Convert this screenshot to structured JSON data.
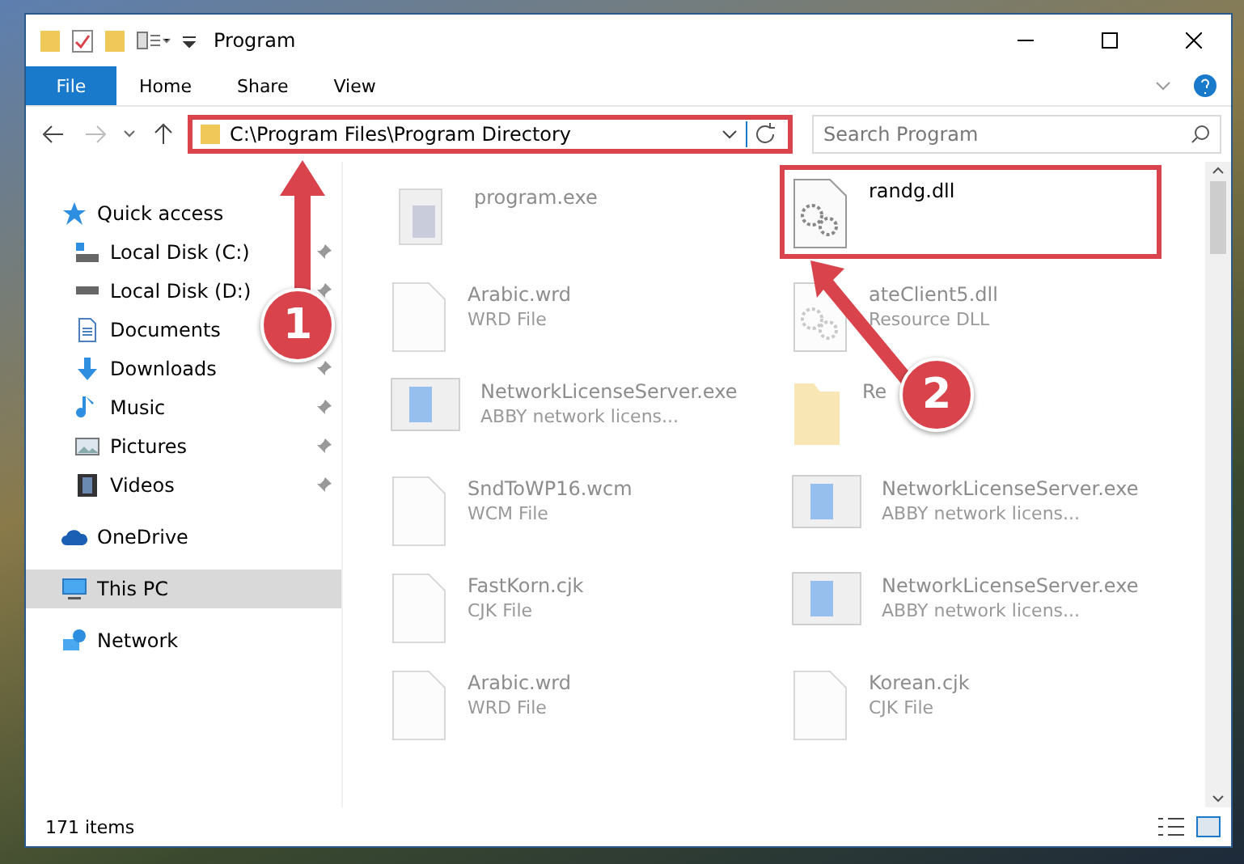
{
  "window": {
    "title": "Program"
  },
  "ribbon_tabs": [
    {
      "label": "File",
      "selected": true
    },
    {
      "label": "Home",
      "selected": false
    },
    {
      "label": "Share",
      "selected": false
    },
    {
      "label": "View",
      "selected": false
    }
  ],
  "address_bar": {
    "value": "C:\\Program Files\\Program Directory",
    "highlighted": true
  },
  "search": {
    "placeholder": "Search Program"
  },
  "sidebar": {
    "items": [
      {
        "label": "Quick access",
        "kind": "star",
        "pinned": false,
        "selected": false,
        "group": true
      },
      {
        "label": "Local Disk (C:)",
        "kind": "drive-c",
        "pinned": true,
        "selected": false,
        "group": false
      },
      {
        "label": "Local Disk (D:)",
        "kind": "drive",
        "pinned": true,
        "selected": false,
        "group": false
      },
      {
        "label": "Documents",
        "kind": "docs",
        "pinned": false,
        "selected": false,
        "group": false
      },
      {
        "label": "Downloads",
        "kind": "download",
        "pinned": true,
        "selected": false,
        "group": false
      },
      {
        "label": "Music",
        "kind": "music",
        "pinned": true,
        "selected": false,
        "group": false
      },
      {
        "label": "Pictures",
        "kind": "pictures",
        "pinned": true,
        "selected": false,
        "group": false
      },
      {
        "label": "Videos",
        "kind": "videos",
        "pinned": true,
        "selected": false,
        "group": false
      },
      {
        "label": "OneDrive",
        "kind": "cloud",
        "pinned": false,
        "selected": false,
        "group": true
      },
      {
        "label": "This PC",
        "kind": "pc",
        "pinned": false,
        "selected": true,
        "group": true
      },
      {
        "label": "Network",
        "kind": "network",
        "pinned": false,
        "selected": false,
        "group": true
      }
    ]
  },
  "files": [
    {
      "name": "program.exe",
      "kind": "app",
      "faded": true,
      "highlighted": false
    },
    {
      "name": "randg.dll",
      "kind": "dll",
      "faded": false,
      "highlighted": true
    },
    {
      "name": "Arabic.wrd",
      "type": "WRD File",
      "kind": "doc",
      "faded": true,
      "highlighted": false
    },
    {
      "name": "ateClient5.dll",
      "type": "Resource DLL",
      "kind": "dll",
      "faded": true,
      "highlighted": false
    },
    {
      "name": "NetworkLicenseServer.exe",
      "type": "ABBY network licens...",
      "kind": "window",
      "faded": true,
      "highlighted": false
    },
    {
      "name": "Re",
      "kind": "folder",
      "faded": true,
      "highlighted": false
    },
    {
      "name": "SndToWP16.wcm",
      "type": "WCM File",
      "kind": "doc",
      "faded": true,
      "highlighted": false
    },
    {
      "name": "NetworkLicenseServer.exe",
      "type": "ABBY network licens...",
      "kind": "window",
      "faded": true,
      "highlighted": false
    },
    {
      "name": "FastKorn.cjk",
      "type": "CJK File",
      "kind": "doc",
      "faded": true,
      "highlighted": false
    },
    {
      "name": "NetworkLicenseServer.exe",
      "type": "ABBY network licens...",
      "kind": "window",
      "faded": true,
      "highlighted": false
    },
    {
      "name": "Arabic.wrd",
      "type": "WRD File",
      "kind": "doc",
      "faded": true,
      "highlighted": false
    },
    {
      "name": "Korean.cjk",
      "type": "CJK File",
      "kind": "doc",
      "faded": true,
      "highlighted": false
    }
  ],
  "status_bar": {
    "count": "171 items"
  },
  "callouts": [
    {
      "label": "1"
    },
    {
      "label": "2"
    }
  ]
}
